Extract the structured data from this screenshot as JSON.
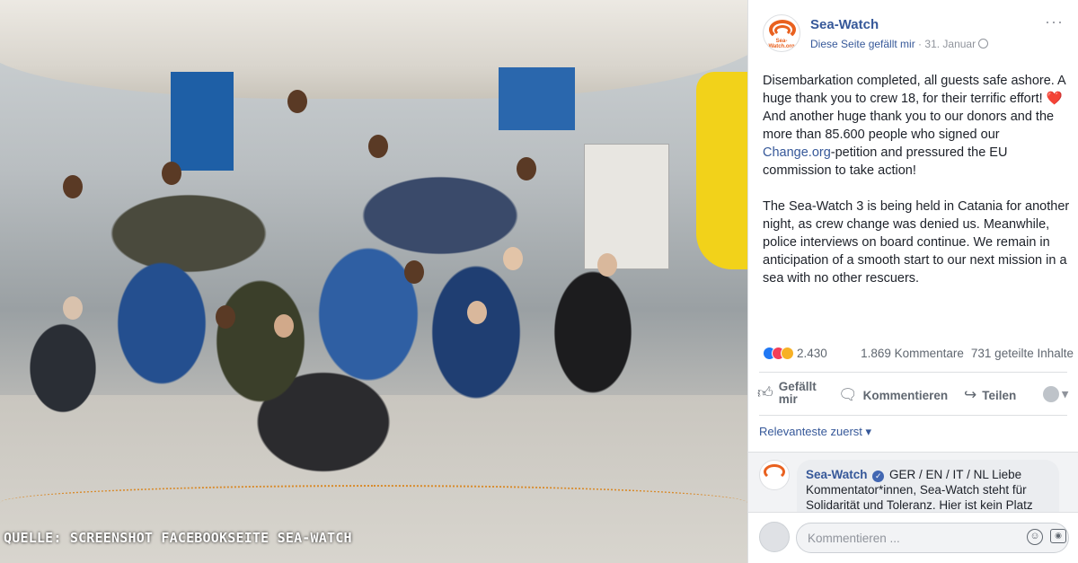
{
  "photo": {
    "caption": "QUELLE: SCREENSHOT FACEBOOKSEITE SEA-WATCH"
  },
  "post": {
    "page_name": "Sea-Watch",
    "avatar_text": "Sea-Watch.org",
    "liked_status": "Diese Seite gefällt mir",
    "separator": " · ",
    "date": "31. Januar",
    "paragraph1_a": "Disembarkation completed, all guests safe ashore. A huge thank you to crew 18, for their terrific effort! ",
    "heart": "❤️",
    "paragraph1_b": " And another huge thank you to our donors and the more than 85.600 people who signed our ",
    "link_text": "Change.org",
    "paragraph1_c": "-petition and pressured the EU commission to take action!",
    "paragraph2": "The Sea-Watch 3 is being held in Catania for another night, as crew change was denied us. Meanwhile, police interviews on board continue. We remain in anticipation of a smooth start to our next mission in a sea with no other rescuers."
  },
  "stats": {
    "reaction_count": "2.430",
    "comments": "1.869 Kommentare",
    "shares": "731 geteilte Inhalte"
  },
  "actions": {
    "like_line1": "Gefällt",
    "like_line2": "mir",
    "comment": "Kommentieren",
    "share": "Teilen"
  },
  "sort": {
    "label": "Relevanteste zuerst ▾"
  },
  "comment": {
    "author": "Sea-Watch",
    "verified_mark": "✓",
    "text": "GER / EN / IT / NL Liebe Kommentator*innen, Sea-Watch steht für Solidarität und Toleranz. Hier ist kein Platz"
  },
  "input": {
    "placeholder": "Kommentieren ..."
  },
  "icons": {
    "like": "like-icon",
    "comment": "comment-icon",
    "share": "share-icon",
    "globe": "globe-icon"
  }
}
